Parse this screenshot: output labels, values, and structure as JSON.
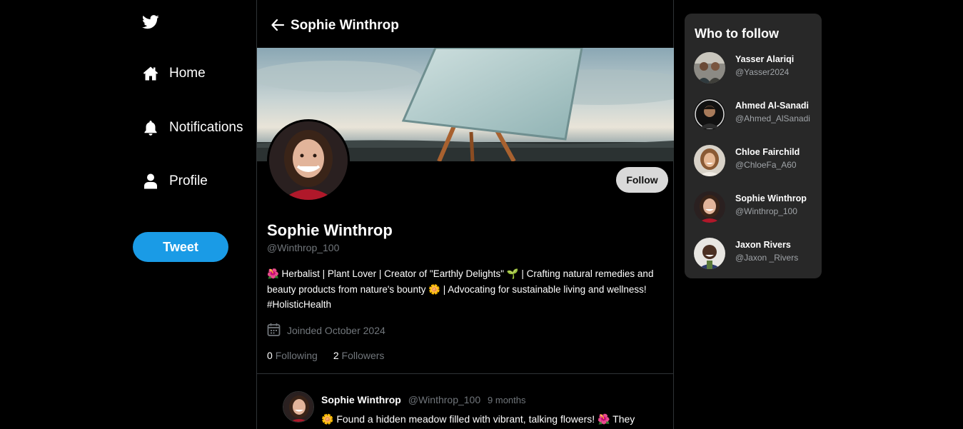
{
  "sidebar": {
    "logo_icon": "twitter-bird-icon",
    "items": [
      {
        "label": "Home",
        "icon": "home-icon"
      },
      {
        "label": "Notifications",
        "icon": "bell-icon"
      },
      {
        "label": "Profile",
        "icon": "user-icon"
      }
    ],
    "tweet_label": "Tweet"
  },
  "header": {
    "title": "Sophie Winthrop",
    "back_icon": "arrow-left-icon"
  },
  "profile": {
    "name": "Sophie Winthrop",
    "handle": "@Winthrop_100",
    "follow_label": "Follow",
    "bio": "🌺 Herbalist | Plant Lover | Creator of \"Earthly Delights\" 🌱 | Crafting natural remedies and beauty products from nature's bounty 🌼 | Advocating for sustainable living and wellness! #HolisticHealth",
    "joined": "Joinded October 2024",
    "following_count": "0",
    "following_label": "Following",
    "followers_count": "2",
    "followers_label": "Followers"
  },
  "tweet": {
    "name": "Sophie Winthrop",
    "handle": "@Winthrop_100",
    "time": "9 months",
    "text": "🌼 Found a hidden meadow filled with vibrant, talking flowers! 🌺 They"
  },
  "who_to_follow": {
    "title": "Who to follow",
    "users": [
      {
        "name": "Yasser Alariqi",
        "handle": "@Yasser2024"
      },
      {
        "name": "Ahmed Al-Sanadi",
        "handle": "@Ahmed_AlSanadi"
      },
      {
        "name": "Chloe Fairchild",
        "handle": "@ChloeFa_A60"
      },
      {
        "name": "Sophie Winthrop",
        "handle": "@Winthrop_100"
      },
      {
        "name": "Jaxon Rivers",
        "handle": "@Jaxon _Rivers"
      }
    ]
  },
  "colors": {
    "accent": "#1a9be6",
    "background": "#000000",
    "panel": "#282828",
    "muted": "#71767b"
  }
}
